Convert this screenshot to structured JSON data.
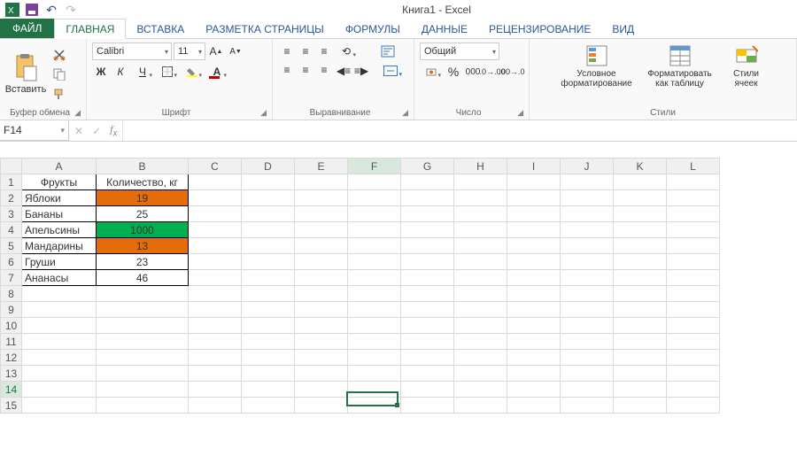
{
  "app": {
    "title": "Книга1 - Excel"
  },
  "qat": {
    "save": "💾",
    "undo": "↶",
    "redo": "↷"
  },
  "tabs": {
    "file": "ФАЙЛ",
    "items": [
      "ГЛАВНАЯ",
      "ВСТАВКА",
      "РАЗМЕТКА СТРАНИЦЫ",
      "ФОРМУЛЫ",
      "ДАННЫЕ",
      "РЕЦЕНЗИРОВАНИЕ",
      "ВИД"
    ],
    "active_index": 0
  },
  "ribbon": {
    "clipboard": {
      "paste": "Вставить",
      "label": "Буфер обмена"
    },
    "font": {
      "name": "Calibri",
      "size": "11",
      "bold": "Ж",
      "italic": "К",
      "underline": "Ч",
      "label": "Шрифт"
    },
    "alignment": {
      "label": "Выравнивание"
    },
    "number": {
      "format": "Общий",
      "label": "Число",
      "percent": "%",
      "comma": "000"
    },
    "styles": {
      "cond": "Условное форматирование",
      "table": "Форматировать как таблицу",
      "cell": "Стили ячеек",
      "label": "Стили"
    }
  },
  "namebox": "F14",
  "formula": "",
  "columns": [
    "A",
    "B",
    "C",
    "D",
    "E",
    "F",
    "G",
    "H",
    "I",
    "J",
    "K",
    "L"
  ],
  "rows": 15,
  "selected_cell": {
    "row": 14,
    "col": "F"
  },
  "data": {
    "header": [
      "Фрукты",
      "Количество, кг"
    ],
    "rows": [
      {
        "a": "Яблоки",
        "b": "19",
        "fill": "orange"
      },
      {
        "a": "Бананы",
        "b": "25",
        "fill": ""
      },
      {
        "a": "Апельсины",
        "b": "1000",
        "fill": "green"
      },
      {
        "a": "Мандарины",
        "b": "13",
        "fill": "orange"
      },
      {
        "a": "Груши",
        "b": "23",
        "fill": ""
      },
      {
        "a": "Ананасы",
        "b": "46",
        "fill": ""
      }
    ]
  },
  "colors": {
    "excel_green": "#217346",
    "orange": "#e46c0a",
    "green_fill": "#00b050"
  },
  "chart_data": {
    "type": "table",
    "title": "Фрукты / Количество, кг",
    "categories": [
      "Яблоки",
      "Бананы",
      "Апельсины",
      "Мандарины",
      "Груши",
      "Ананасы"
    ],
    "values": [
      19,
      25,
      1000,
      13,
      23,
      46
    ]
  }
}
